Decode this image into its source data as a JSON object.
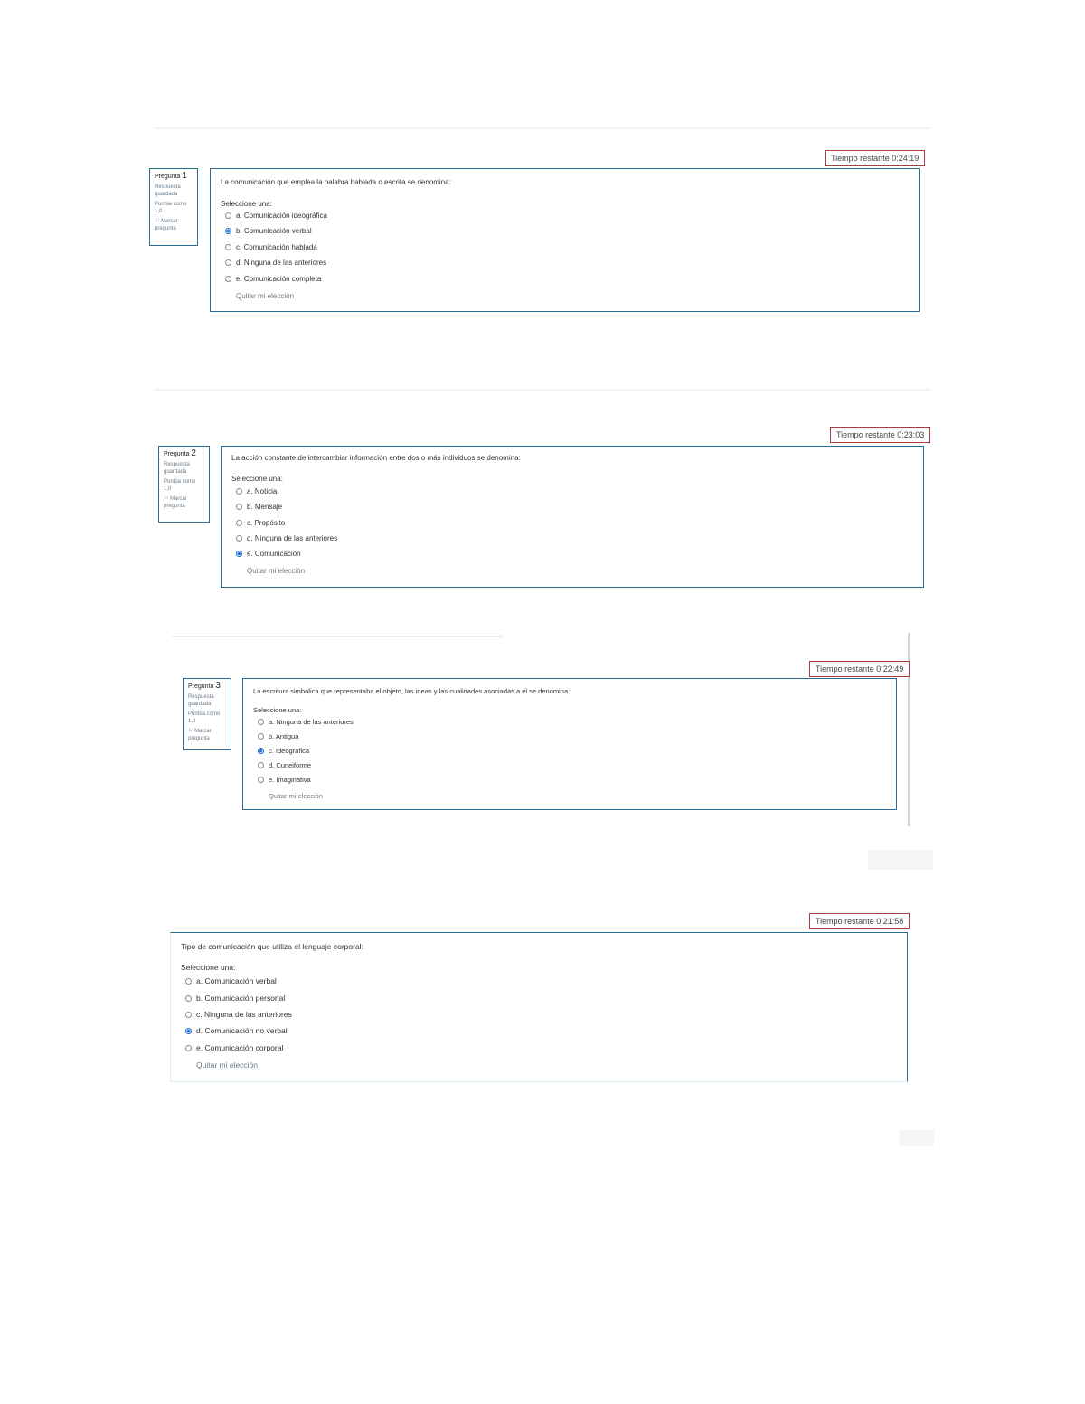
{
  "questions": [
    {
      "timer": "Tiempo restante 0:24:19",
      "info": {
        "label": "Pregunta",
        "number": "1",
        "status": "Respuesta guardada",
        "points": "Puntúa como 1,0",
        "flag": "Marcar pregunta"
      },
      "text": "La comunicación que emplea la palabra hablada o escrita se denomina:",
      "prompt": "Seleccione una:",
      "options": [
        {
          "label": "a. Comunicación ideográfica",
          "selected": false
        },
        {
          "label": "b. Comunicación verbal",
          "selected": true
        },
        {
          "label": "c. Comunicación hablada",
          "selected": false
        },
        {
          "label": "d. Ninguna de las anteriores",
          "selected": false
        },
        {
          "label": "e. Comunicación completa",
          "selected": false
        }
      ],
      "clear": "Quitar mi elección"
    },
    {
      "timer": "Tiempo restante 0:23:03",
      "info": {
        "label": "Pregunta",
        "number": "2",
        "status": "Respuesta guardada",
        "points": "Puntúa como 1,0",
        "flag": "Marcar pregunta"
      },
      "text": "La acción constante de intercambiar información entre dos o más individuos se denomina:",
      "prompt": "Seleccione una:",
      "options": [
        {
          "label": "a. Noticia",
          "selected": false
        },
        {
          "label": "b. Mensaje",
          "selected": false
        },
        {
          "label": "c. Propósito",
          "selected": false
        },
        {
          "label": "d. Ninguna de las anteriores",
          "selected": false
        },
        {
          "label": "e. Comunicación",
          "selected": true
        }
      ],
      "clear": "Quitar mi elección"
    },
    {
      "timer": "Tiempo restante 0:22:49",
      "info": {
        "label": "Pregunta",
        "number": "3",
        "status": "Respuesta guardada",
        "points": "Puntúa como 1,0",
        "flag": "Marcar pregunta"
      },
      "text": "La escritura simbólica que representaba el objeto, las ideas y las cualidades asociadas a él se denomina:",
      "prompt": "Seleccione una:",
      "options": [
        {
          "label": "a. Ninguna de las anteriores",
          "selected": false
        },
        {
          "label": "b. Antigua",
          "selected": false
        },
        {
          "label": "c. Ideográfica",
          "selected": true
        },
        {
          "label": "d. Cuneiforme",
          "selected": false
        },
        {
          "label": "e. Imaginativa",
          "selected": false
        }
      ],
      "clear": "Quitar mi elección"
    },
    {
      "timer": "Tiempo restante 0:21:58",
      "text": "Tipo de comunicación que utiliza el lenguaje corporal:",
      "prompt": "Seleccione una:",
      "options": [
        {
          "label": "a. Comunicación verbal",
          "selected": false
        },
        {
          "label": "b. Comunicación personal",
          "selected": false
        },
        {
          "label": "c. Ninguna de las anteriores",
          "selected": false
        },
        {
          "label": "d. Comunicación no verbal",
          "selected": true
        },
        {
          "label": "e. Comunicación corporal",
          "selected": false
        }
      ],
      "clear": "Quitar mi elección"
    }
  ]
}
